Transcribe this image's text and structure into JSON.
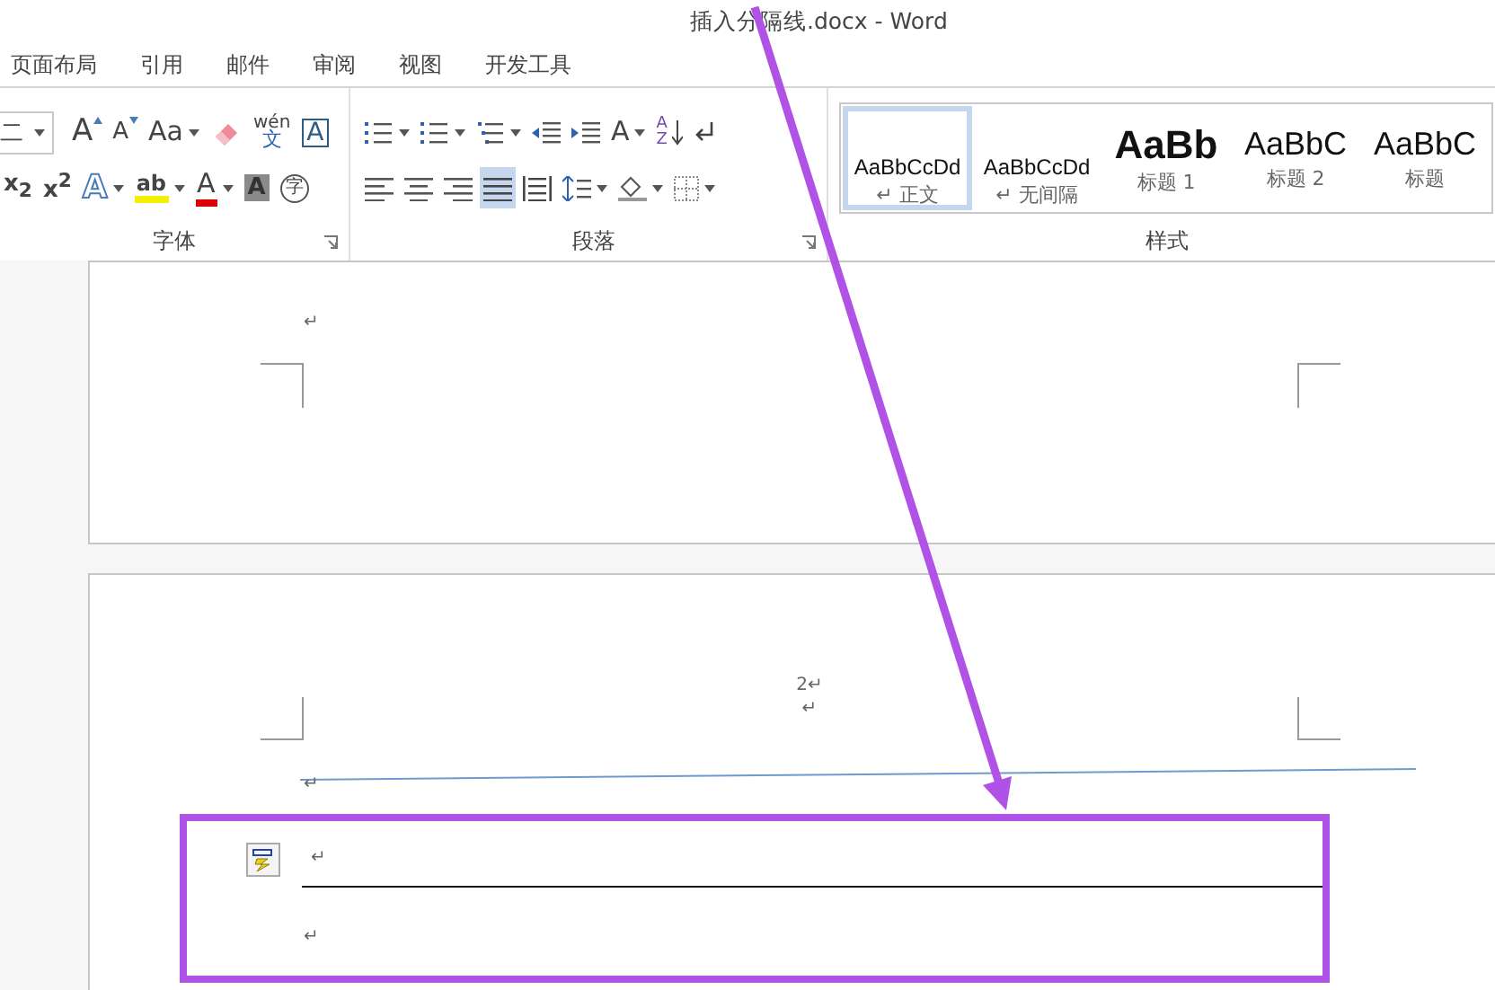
{
  "window": {
    "title": "插入分隔线.docx - Word"
  },
  "tabs": [
    {
      "label": "页面布局",
      "selected": false
    },
    {
      "label": "引用",
      "selected": false
    },
    {
      "label": "邮件",
      "selected": false
    },
    {
      "label": "审阅",
      "selected": false
    },
    {
      "label": "视图",
      "selected": false
    },
    {
      "label": "开发工具",
      "selected": false
    }
  ],
  "ribbon": {
    "font_group": {
      "label": "字体",
      "rows": [
        [
          {
            "kind": "font-size",
            "text": "二",
            "dropdown": true
          },
          {
            "kind": "grow-font",
            "text": "A"
          },
          {
            "kind": "shrink-font",
            "text": "A"
          },
          {
            "kind": "change-case",
            "text": "Aa",
            "dropdown": true
          },
          {
            "kind": "clear-format"
          },
          {
            "kind": "phonetic",
            "lines": [
              "wén",
              "文"
            ]
          },
          {
            "kind": "char-border",
            "text": "A"
          }
        ],
        [
          {
            "kind": "subscript",
            "text": "x$_{2}$"
          },
          {
            "kind": "superscript",
            "text": "x$^{2}$"
          },
          {
            "kind": "text-effect",
            "text": "A",
            "dropdown": true
          },
          {
            "kind": "highlight",
            "text": "ab",
            "dropdown": true
          },
          {
            "kind": "font-color",
            "text": "A",
            "dropdown": true
          },
          {
            "kind": "char-shading",
            "text": "A"
          },
          {
            "kind": "enclosed-char",
            "text": "字"
          }
        ]
      ]
    },
    "paragraph_group": {
      "label": "段落",
      "rows": [
        [
          {
            "kind": "bullets",
            "dropdown": true
          },
          {
            "kind": "numbering",
            "dropdown": true
          },
          {
            "kind": "multilevel",
            "dropdown": true
          },
          {
            "kind": "decrease-indent"
          },
          {
            "kind": "increase-indent"
          },
          {
            "kind": "chinese-layout",
            "text": "A",
            "dropdown": true
          },
          {
            "kind": "sort",
            "lines": [
              "A",
              "Z"
            ]
          },
          {
            "kind": "show-marks"
          }
        ],
        [
          {
            "kind": "align-left",
            "selected": false
          },
          {
            "kind": "align-center",
            "selected": false
          },
          {
            "kind": "align-right",
            "selected": false
          },
          {
            "kind": "justify",
            "selected": true
          },
          {
            "kind": "distributed",
            "selected": false
          },
          {
            "kind": "line-spacing",
            "dropdown": true
          },
          {
            "kind": "shading",
            "dropdown": true
          },
          {
            "kind": "borders",
            "dropdown": true
          }
        ]
      ]
    },
    "styles_group": {
      "label": "样式",
      "items": [
        {
          "preview": "AaBbCcDd",
          "label": "↵ 正文",
          "kind": "body",
          "selected": true
        },
        {
          "preview": "AaBbCcDd",
          "label": "↵ 无间隔",
          "kind": "body",
          "selected": false
        },
        {
          "preview": "AaBb",
          "label": "标题 1",
          "kind": "heading1",
          "selected": false
        },
        {
          "preview": "AaBbC",
          "label": "标题 2",
          "kind": "heading2",
          "selected": false
        },
        {
          "preview": "AaBbC",
          "label": "标题",
          "kind": "title",
          "selected": false
        }
      ]
    }
  },
  "document": {
    "page_1": {
      "paragraphs": [
        "↵"
      ]
    },
    "page_2": {
      "header_lines": [
        "2↵",
        "↵"
      ],
      "header_end_mark": "↵",
      "body": [
        {
          "kind": "paragraph",
          "text": "↵",
          "paste_options": true
        },
        {
          "kind": "rule"
        },
        {
          "kind": "paragraph",
          "text": "↵",
          "paste_options": false
        }
      ]
    }
  }
}
